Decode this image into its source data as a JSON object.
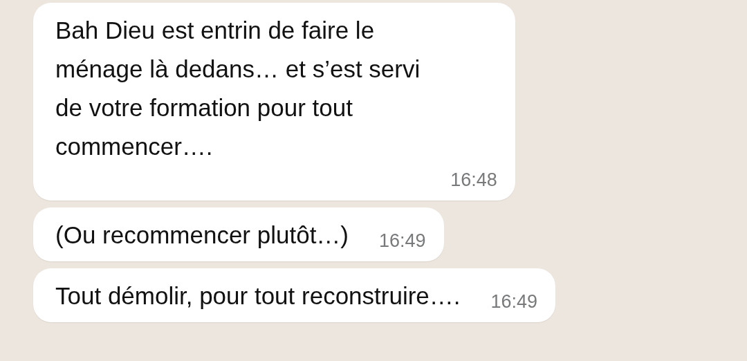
{
  "messages": [
    {
      "text": "Bah Dieu est entrin de faire le\nménage là dedans… et s’est servi\nde votre formation pour tout\ncommencer….",
      "time": "16:48"
    },
    {
      "text": "(Ou recommencer plutôt…)",
      "time": "16:49"
    },
    {
      "text": "Tout démolir, pour tout reconstruire….",
      "time": "16:49"
    }
  ]
}
